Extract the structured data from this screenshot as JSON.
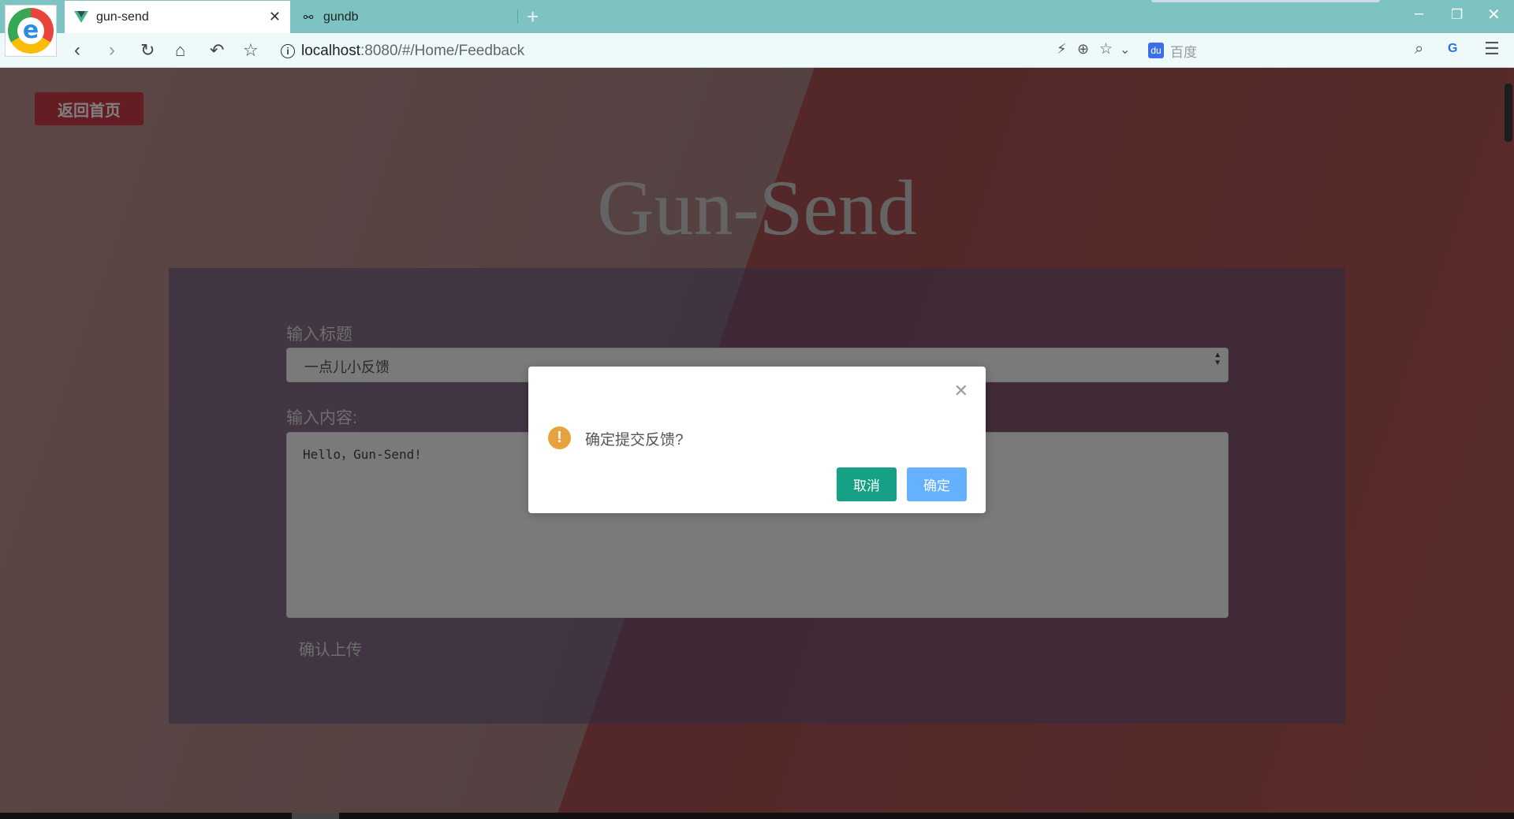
{
  "browser": {
    "tabs": [
      {
        "title": "gun-send",
        "active": true,
        "favicon": "vue-icon"
      },
      {
        "title": "gundb",
        "active": false,
        "favicon": "gundb-icon"
      }
    ],
    "url_host": "localhost",
    "url_rest": ":8080/#/Home/Feedback",
    "search_placeholder": "百度"
  },
  "page": {
    "back_button": "返回首页",
    "site_title": "Gun-Send",
    "title_label": "输入标题",
    "title_value": "一点儿小反馈",
    "content_label": "输入内容:",
    "content_value": "Hello，Gun-Send!",
    "upload_button": "确认上传"
  },
  "dialog": {
    "message": "确定提交反馈?",
    "cancel": "取消",
    "confirm": "确定",
    "icon": "warning-icon"
  },
  "colors": {
    "accent_teal": "#16a085",
    "confirm_blue": "#66b1ff",
    "back_red": "#c93a45",
    "warning": "#e6a23c"
  }
}
